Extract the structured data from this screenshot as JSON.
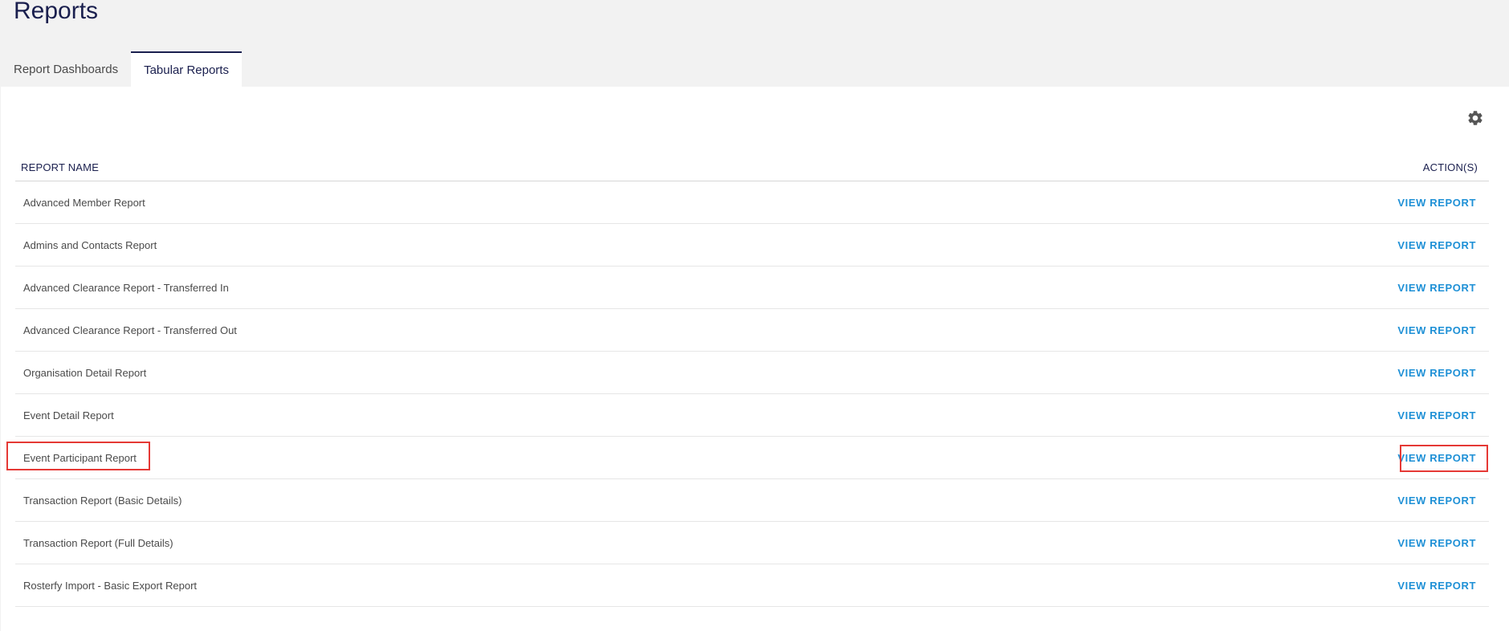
{
  "page": {
    "title": "Reports"
  },
  "tabs": [
    {
      "label": "Report Dashboards",
      "active": false
    },
    {
      "label": "Tabular Reports",
      "active": true
    }
  ],
  "toolbar": {
    "settings_icon": "gear-icon"
  },
  "table": {
    "headers": {
      "name": "REPORT NAME",
      "action": "ACTION(S)"
    },
    "rows": [
      {
        "name": "Advanced Member Report",
        "action": "VIEW REPORT"
      },
      {
        "name": "Admins and Contacts Report",
        "action": "VIEW REPORT"
      },
      {
        "name": "Advanced Clearance Report - Transferred In",
        "action": "VIEW REPORT"
      },
      {
        "name": "Advanced Clearance Report - Transferred Out",
        "action": "VIEW REPORT"
      },
      {
        "name": "Organisation Detail Report",
        "action": "VIEW REPORT"
      },
      {
        "name": "Event Detail Report",
        "action": "VIEW REPORT"
      },
      {
        "name": "Event Participant Report",
        "action": "VIEW REPORT",
        "highlighted": true
      },
      {
        "name": "Transaction Report (Basic Details)",
        "action": "VIEW REPORT"
      },
      {
        "name": "Transaction Report (Full Details)",
        "action": "VIEW REPORT"
      },
      {
        "name": "Rosterfy Import - Basic Export Report",
        "action": "VIEW REPORT"
      }
    ]
  },
  "colors": {
    "heading": "#1a1f4e",
    "link": "#1e90d6",
    "highlight": "#e53935",
    "background": "#f2f2f2",
    "panel": "#ffffff"
  }
}
